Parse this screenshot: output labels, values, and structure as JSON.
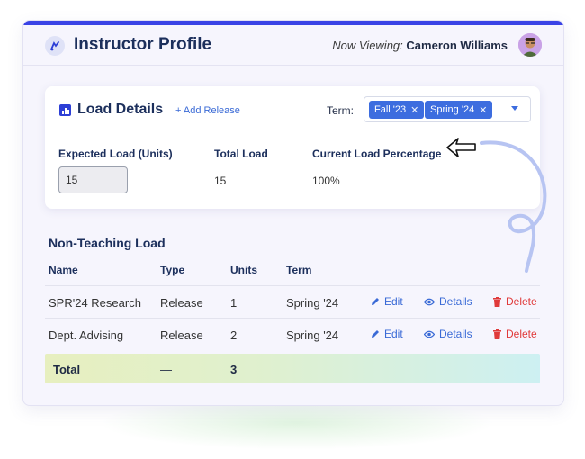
{
  "header": {
    "title": "Instructor Profile",
    "viewing_label": "Now Viewing:",
    "viewing_name": "Cameron Williams"
  },
  "load_details": {
    "title": "Load Details",
    "add_release": "+ Add Release",
    "term_label": "Term:",
    "selected_terms": [
      "Fall '23",
      "Spring '24"
    ],
    "columns": [
      "Expected Load (Units)",
      "Total Load",
      "Current Load Percentage"
    ],
    "expected_load": "15",
    "total_load": "15",
    "current_load_percentage": "100%"
  },
  "non_teaching": {
    "title": "Non-Teaching Load",
    "headers": [
      "Name",
      "Type",
      "Units",
      "Term"
    ],
    "rows": [
      {
        "name": "SPR'24 Research",
        "type": "Release",
        "units": "1",
        "term": "Spring '24"
      },
      {
        "name": "Dept. Advising",
        "type": "Release",
        "units": "2",
        "term": "Spring '24"
      }
    ],
    "actions": {
      "edit": "Edit",
      "details": "Details",
      "delete": "Delete"
    },
    "total": {
      "label": "Total",
      "type": "—",
      "units": "3"
    }
  },
  "colors": {
    "accent": "#3a43e6",
    "chip": "#3d6ddf",
    "link": "#3a6ad6",
    "delete": "#e03a3a",
    "title": "#1c2f5c"
  },
  "icons": [
    "logo-icon",
    "avatar",
    "bar-chart-icon",
    "close-icon",
    "chevron-down-icon",
    "pencil-icon",
    "eye-icon",
    "trash-icon",
    "cursor-arrow-icon"
  ]
}
